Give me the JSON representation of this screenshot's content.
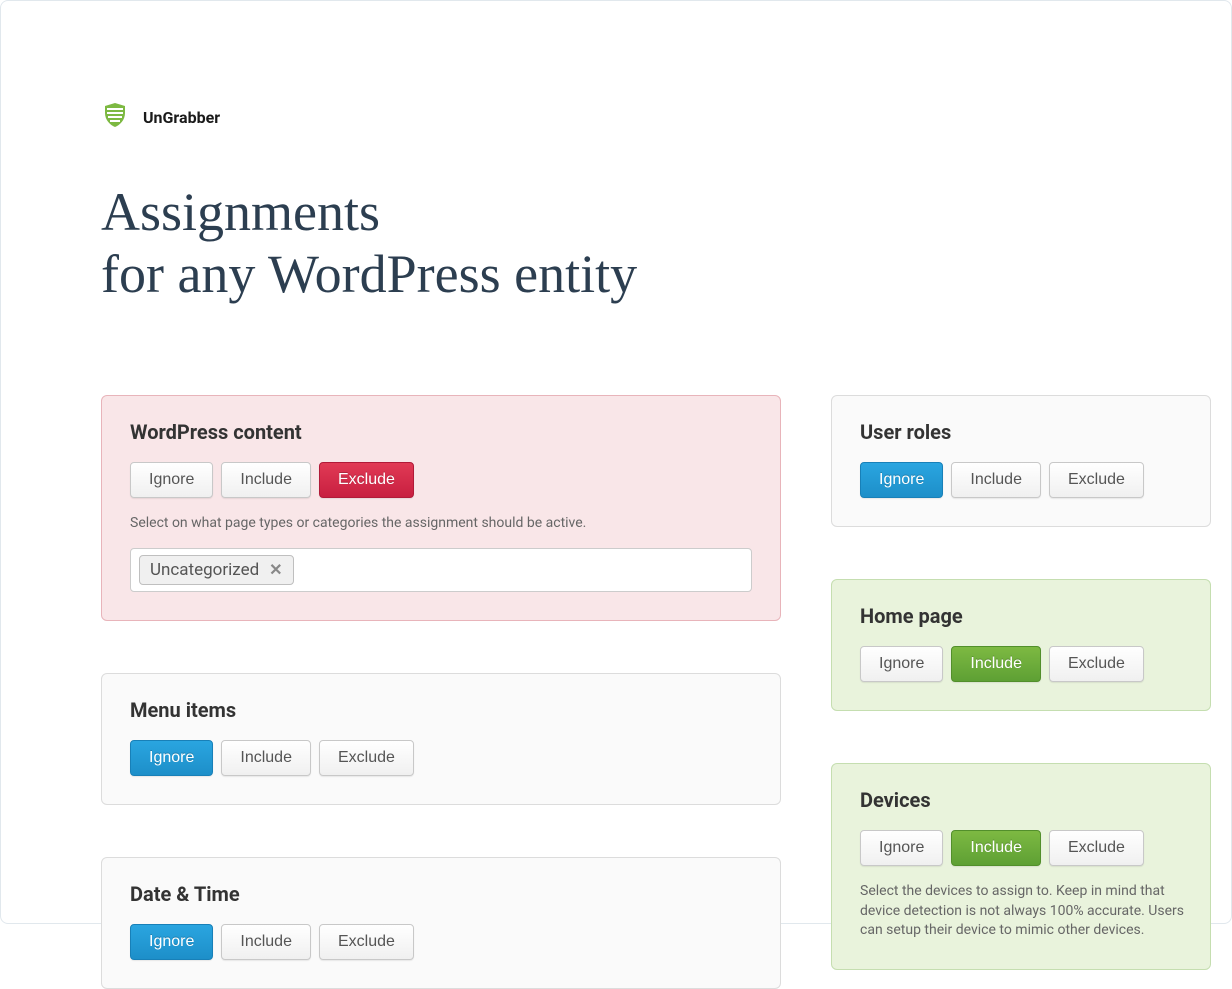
{
  "brand": {
    "name": "UnGrabber"
  },
  "heading": {
    "line1": "Assignments",
    "line2": "for any WordPress entity"
  },
  "labels": {
    "ignore": "Ignore",
    "include": "Include",
    "exclude": "Exclude"
  },
  "cards": {
    "wordpress_content": {
      "title": "WordPress content",
      "hint": "Select on what page types or categories the assignment should be active.",
      "tag": "Uncategorized"
    },
    "menu_items": {
      "title": "Menu items"
    },
    "date_time": {
      "title": "Date & Time"
    },
    "user_roles": {
      "title": "User roles"
    },
    "home_page": {
      "title": "Home page"
    },
    "devices": {
      "title": "Devices",
      "hint": "Select the devices to assign to. Keep in mind that device detection is not always 100% accurate. Users can setup their device to mimic other devices."
    }
  }
}
